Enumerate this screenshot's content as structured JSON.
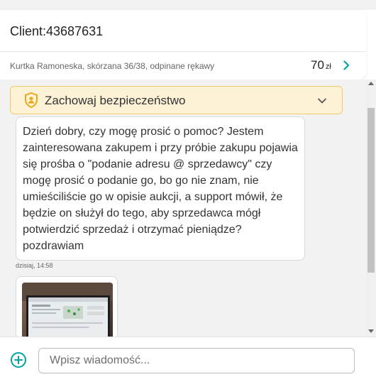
{
  "header": {
    "client_label": "Client:43687631",
    "product_title": "Kurtka Ramoneska, skórzana 36/38, odpinane rękawy",
    "price_value": "70",
    "price_currency": "zł"
  },
  "safety_banner": {
    "text": "Zachowaj bezpieczeństwo"
  },
  "messages": [
    {
      "text": "Dzień dobry, czy mogę prosić o pomoc? Jestem zainteresowana zakupem i przy próbie zakupu pojawia się prośba o \"podanie adresu @ sprzedawcy\" czy mogę prosić o podanie go, bo go nie znam, nie umieściliście go w opisie aukcji, a support mówił, że będzie on służył do tego, aby sprzedawca mógł potwierdzić sprzedaż i otrzymać pieniądze? pozdrawiam",
      "timestamp": "dzisiaj, 14:58"
    }
  ],
  "composer": {
    "placeholder": "Wpisz wiadomość..."
  },
  "colors": {
    "accent": "#00a3a3",
    "banner_bg": "#fdf2d6",
    "banner_border": "#f0ca6a",
    "shield": "#e9a91c"
  },
  "icons": {
    "price_chevron": "chevron-right-icon",
    "banner_icon": "shield-user-icon",
    "banner_toggle": "chevron-down-icon",
    "add_attachment": "plus-circle-icon"
  }
}
